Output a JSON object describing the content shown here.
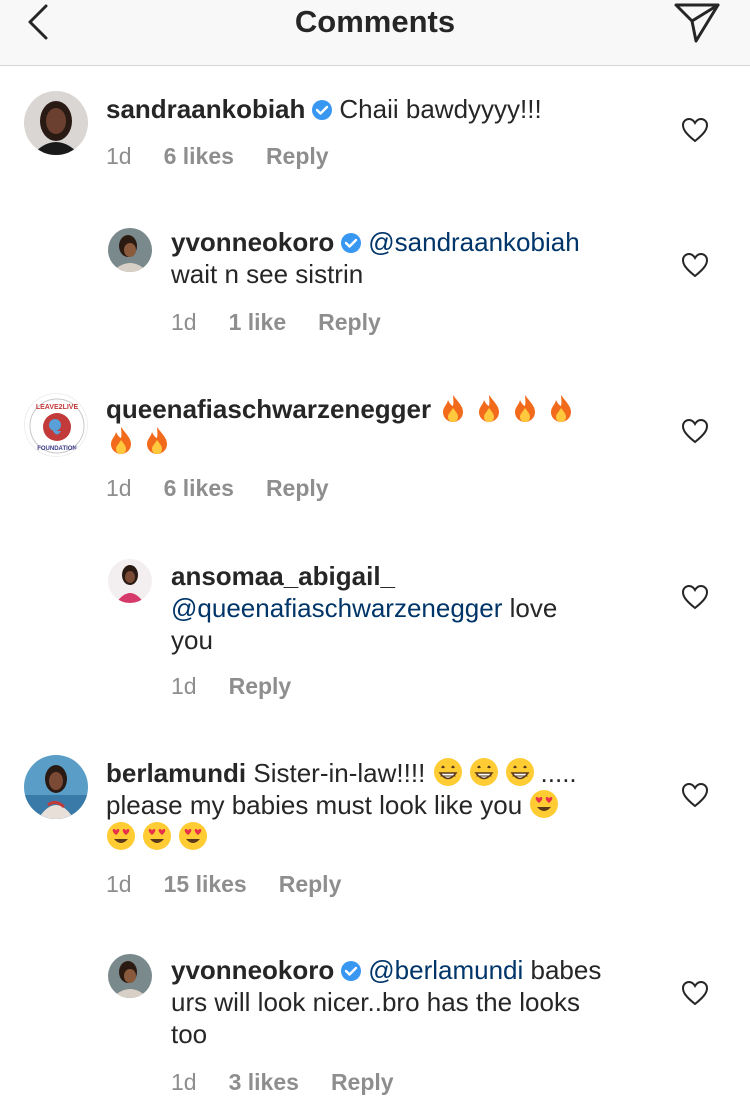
{
  "header": {
    "title": "Comments",
    "back_icon": "chevron-left-icon",
    "send_icon": "paper-plane-icon"
  },
  "colors": {
    "text": "#262626",
    "muted": "#8e8e8e",
    "mention": "#003569",
    "verified": "#3897f0",
    "fire": "#f26a1b",
    "header_bg": "#f8f8f8"
  },
  "comments": [
    {
      "username": "sandraankobiah",
      "verified": true,
      "text_lines": [
        "Chaii bawdyyyy!!!"
      ],
      "time": "1d",
      "likes": "6 likes",
      "reply": "Reply"
    },
    {
      "username": "yvonneokoro",
      "verified": true,
      "mention": "@sandraankobiah",
      "text_line2": "wait n see sistrin",
      "time": "1d",
      "likes": "1 like",
      "reply": "Reply"
    },
    {
      "username": "queenafiaschwarzenegger",
      "verified": false,
      "emoji": "fire",
      "time": "1d",
      "likes": "6 likes",
      "reply": "Reply"
    },
    {
      "username": "ansomaa_abigail_",
      "verified": false,
      "mention": "@queenafiaschwarzenegger",
      "after_mention": " love",
      "text_line3": "you",
      "time": "1d",
      "reply": "Reply"
    },
    {
      "username": "berlamundi",
      "verified": false,
      "text_part1": "Sister-in-law!!!!",
      "text_part2": ".....",
      "text_line2": "please my babies must look like you",
      "emoji_grin": "grinning-face",
      "emoji_heart_eyes": "heart-eyes-face",
      "time": "1d",
      "likes": "15 likes",
      "reply": "Reply"
    },
    {
      "username": "yvonneokoro",
      "verified": true,
      "mention": "@berlamundi",
      "after_mention": " babes",
      "text_line2": "urs will look nicer..bro has the looks",
      "text_line3": "too",
      "time": "1d",
      "likes": "3 likes",
      "reply": "Reply"
    }
  ],
  "avatars": {
    "badge_top": "LEAVE2LIVE",
    "badge_bottom": "FOUNDATION"
  },
  "icons": {
    "like": "heart-outline-icon",
    "verified": "verified-badge-icon"
  }
}
